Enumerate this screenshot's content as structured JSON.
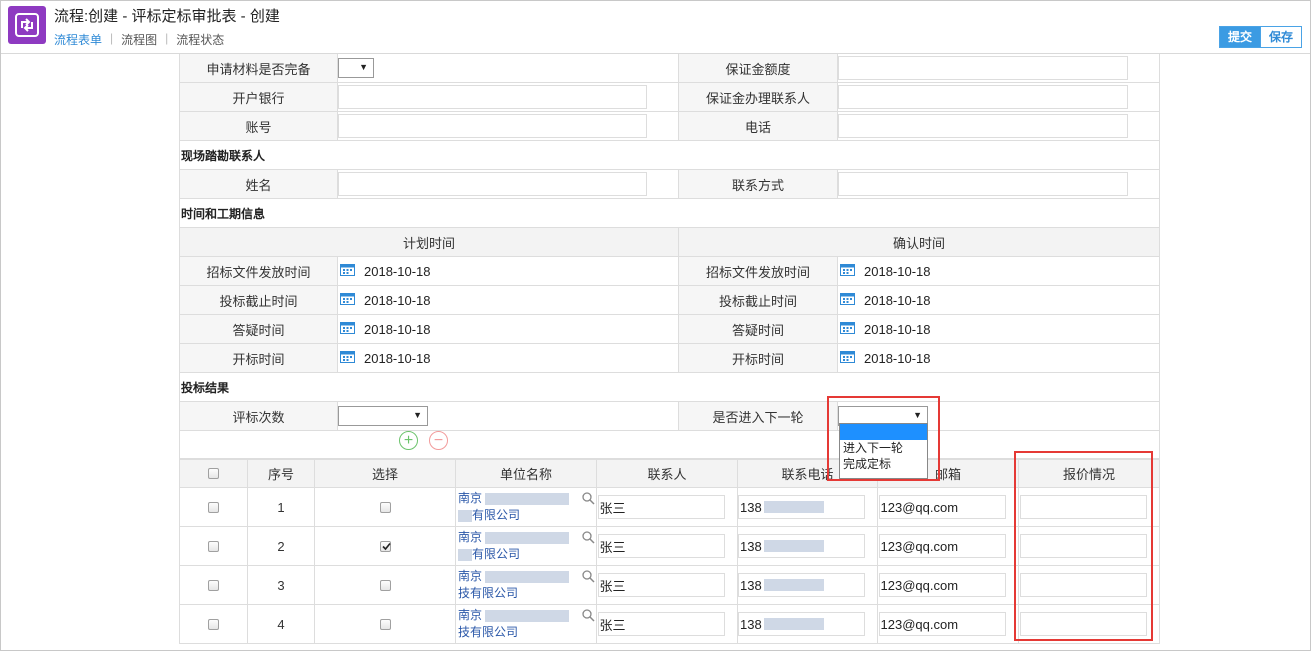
{
  "header": {
    "title": "流程:创建 - 评标定标审批表 - 创建",
    "tabs": [
      "流程表单",
      "流程图",
      "流程状态"
    ],
    "submit_label": "提交",
    "save_label": "保存"
  },
  "bank": {
    "materials_label": "申请材料是否完备",
    "deposit_amount_label": "保证金额度",
    "bank_label": "开户银行",
    "deposit_contact_label": "保证金办理联系人",
    "account_label": "账号",
    "phone_label": "电话"
  },
  "site": {
    "section": "现场踏勘联系人",
    "name_label": "姓名",
    "contact_label": "联系方式"
  },
  "schedule": {
    "section": "时间和工期信息",
    "planned_header": "计划时间",
    "confirmed_header": "确认时间",
    "rows": [
      {
        "label": "招标文件发放时间",
        "planned": "2018-10-18",
        "confirmed": "2018-10-18"
      },
      {
        "label": "投标截止时间",
        "planned": "2018-10-18",
        "confirmed": "2018-10-18"
      },
      {
        "label": "答疑时间",
        "planned": "2018-10-18",
        "confirmed": "2018-10-18"
      },
      {
        "label": "开标时间",
        "planned": "2018-10-18",
        "confirmed": "2018-10-18"
      }
    ]
  },
  "result": {
    "section": "投标结果",
    "rounds_label": "评标次数",
    "next_round_label": "是否进入下一轮",
    "dropdown_options": [
      "",
      "进入下一轮",
      "完成定标"
    ]
  },
  "grid": {
    "columns": [
      "序号",
      "选择",
      "单位名称",
      "联系人",
      "联系电话",
      "邮箱",
      "报价情况"
    ],
    "rows": [
      {
        "no": "1",
        "checked": false,
        "unit_line1": "南京",
        "unit_line2": "有限公司",
        "contact": "张三",
        "phone": "138",
        "email": "123@qq.com"
      },
      {
        "no": "2",
        "checked": true,
        "unit_line1": "南京",
        "unit_line2": "有限公司",
        "contact": "张三",
        "phone": "138",
        "email": "123@qq.com"
      },
      {
        "no": "3",
        "checked": false,
        "unit_line1": "南京",
        "unit_line2": "技有限公司",
        "contact": "张三",
        "phone": "138",
        "email": "123@qq.com"
      },
      {
        "no": "4",
        "checked": false,
        "unit_line1": "南京",
        "unit_line2": "技有限公司",
        "contact": "张三",
        "phone": "138",
        "email": "123@qq.com"
      }
    ]
  },
  "colors": {
    "accent": "#3b9be3",
    "logo": "#8e3ac1",
    "highlight": "#e53935"
  }
}
